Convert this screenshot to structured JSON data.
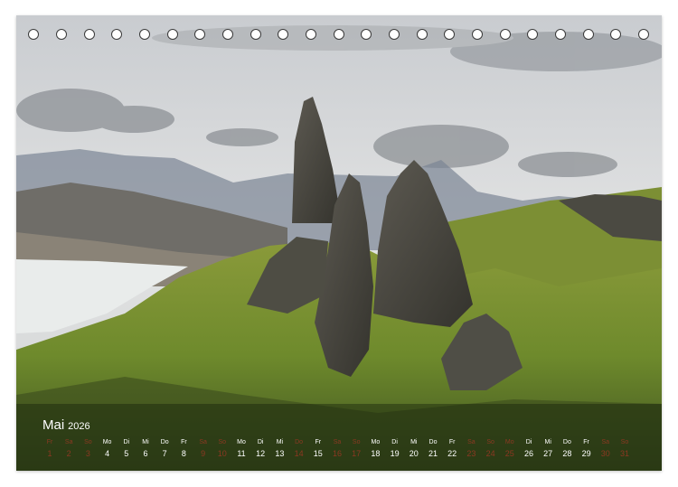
{
  "calendar": {
    "month": "Mai",
    "year": "2026",
    "accent_color": "#d9342b",
    "days": [
      {
        "wd": "Fr",
        "n": "1",
        "type": "we"
      },
      {
        "wd": "Sa",
        "n": "2",
        "type": "we"
      },
      {
        "wd": "So",
        "n": "3",
        "type": "we"
      },
      {
        "wd": "Mo",
        "n": "4",
        "type": ""
      },
      {
        "wd": "Di",
        "n": "5",
        "type": ""
      },
      {
        "wd": "Mi",
        "n": "6",
        "type": ""
      },
      {
        "wd": "Do",
        "n": "7",
        "type": ""
      },
      {
        "wd": "Fr",
        "n": "8",
        "type": ""
      },
      {
        "wd": "Sa",
        "n": "9",
        "type": "we"
      },
      {
        "wd": "So",
        "n": "10",
        "type": "we"
      },
      {
        "wd": "Mo",
        "n": "11",
        "type": ""
      },
      {
        "wd": "Di",
        "n": "12",
        "type": ""
      },
      {
        "wd": "Mi",
        "n": "13",
        "type": ""
      },
      {
        "wd": "Do",
        "n": "14",
        "type": "we"
      },
      {
        "wd": "Fr",
        "n": "15",
        "type": ""
      },
      {
        "wd": "Sa",
        "n": "16",
        "type": "we"
      },
      {
        "wd": "So",
        "n": "17",
        "type": "we"
      },
      {
        "wd": "Mo",
        "n": "18",
        "type": ""
      },
      {
        "wd": "Di",
        "n": "19",
        "type": ""
      },
      {
        "wd": "Mi",
        "n": "20",
        "type": ""
      },
      {
        "wd": "Do",
        "n": "21",
        "type": ""
      },
      {
        "wd": "Fr",
        "n": "22",
        "type": ""
      },
      {
        "wd": "Sa",
        "n": "23",
        "type": "we"
      },
      {
        "wd": "So",
        "n": "24",
        "type": "we"
      },
      {
        "wd": "Mo",
        "n": "25",
        "type": "we"
      },
      {
        "wd": "Di",
        "n": "26",
        "type": ""
      },
      {
        "wd": "Mi",
        "n": "27",
        "type": ""
      },
      {
        "wd": "Do",
        "n": "28",
        "type": ""
      },
      {
        "wd": "Fr",
        "n": "29",
        "type": ""
      },
      {
        "wd": "Sa",
        "n": "30",
        "type": "we"
      },
      {
        "wd": "So",
        "n": "31",
        "type": "we"
      }
    ]
  }
}
